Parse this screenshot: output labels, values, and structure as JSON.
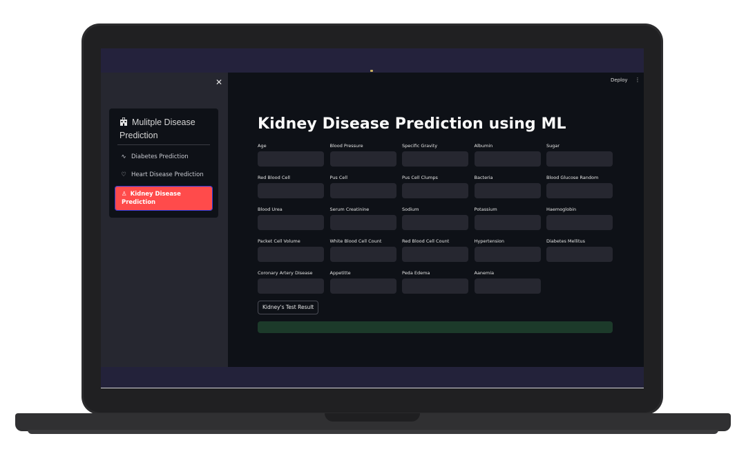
{
  "sidebar": {
    "close_icon": "close-icon",
    "menu_title": "Mulitple Disease Prediction",
    "title_icon": "hospital-icon",
    "items": [
      {
        "label": "Diabetes Prediction",
        "icon": "activity-icon",
        "glyph": "∿"
      },
      {
        "label": "Heart Disease Prediction",
        "icon": "heart-icon",
        "glyph": "♡"
      },
      {
        "label": "Kidney Disease Prediction",
        "icon": "person-icon",
        "glyph": "♙"
      }
    ],
    "active_index": 2
  },
  "header": {
    "deploy_label": "Deploy",
    "menu_glyph": "⋮"
  },
  "main": {
    "title": "Kidney Disease Prediction using ML",
    "fields": [
      {
        "label": "Age",
        "value": ""
      },
      {
        "label": "Blood Pressure",
        "value": ""
      },
      {
        "label": "Specific Gravity",
        "value": ""
      },
      {
        "label": "Albumin",
        "value": ""
      },
      {
        "label": "Sugar",
        "value": ""
      },
      {
        "label": "Red Blood Cell",
        "value": ""
      },
      {
        "label": "Pus Cell",
        "value": ""
      },
      {
        "label": "Pus Cell Clumps",
        "value": ""
      },
      {
        "label": "Bacteria",
        "value": ""
      },
      {
        "label": "Blood Glucose Random",
        "value": ""
      },
      {
        "label": "Blood Urea",
        "value": ""
      },
      {
        "label": "Serum Creatinine",
        "value": ""
      },
      {
        "label": "Sodium",
        "value": ""
      },
      {
        "label": "Potassium",
        "value": ""
      },
      {
        "label": "Haemoglobin",
        "value": ""
      },
      {
        "label": "Packet Cell Volume",
        "value": ""
      },
      {
        "label": "White Blood Cell Count",
        "value": ""
      },
      {
        "label": "Red Blood Cell Count",
        "value": ""
      },
      {
        "label": "Hypertension",
        "value": ""
      },
      {
        "label": "Diabetes Mellitus",
        "value": ""
      },
      {
        "label": "Coronary Artery Disease",
        "value": ""
      },
      {
        "label": "Appetitte",
        "value": ""
      },
      {
        "label": "Peda Edema",
        "value": ""
      },
      {
        "label": "Aanemia",
        "value": ""
      }
    ],
    "submit_label": "Kidney's Test Result",
    "result_text": ""
  },
  "colors": {
    "accent": "#ff4b4b",
    "background": "#0e1117",
    "sidebar": "#262730",
    "result": "#1c3a2a"
  }
}
